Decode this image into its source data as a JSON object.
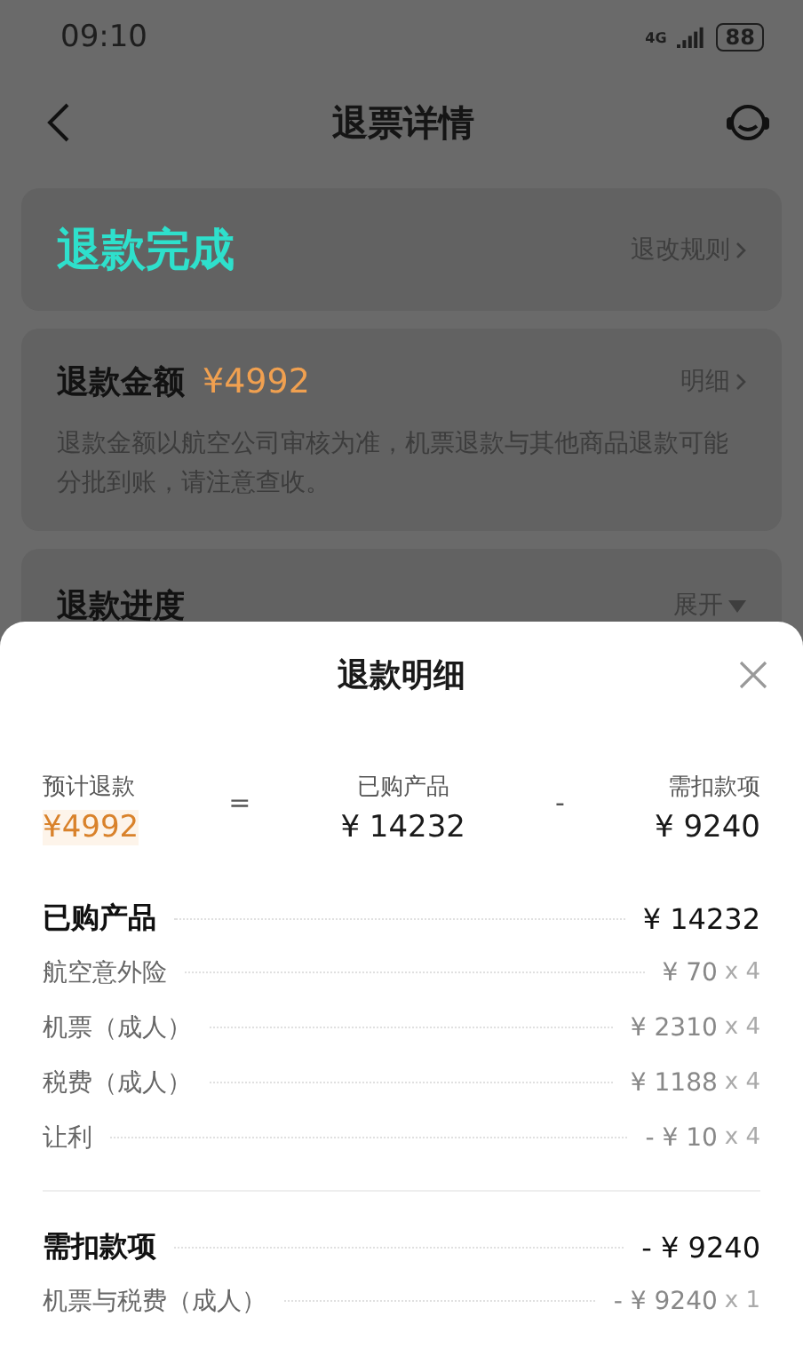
{
  "status_bar": {
    "time": "09:10",
    "network": "4G",
    "battery": "88"
  },
  "header": {
    "title": "退票详情"
  },
  "status_card": {
    "status": "退款完成",
    "link": "退改规则"
  },
  "amount_card": {
    "label": "退款金额",
    "amount": "¥4992",
    "link": "明细",
    "note": "退款金额以航空公司审核为准，机票退款与其他商品退款可能分批到账，请注意查收。"
  },
  "progress_card": {
    "label": "退款进度",
    "toggle": "展开"
  },
  "sheet": {
    "title": "退款明细",
    "formula": [
      {
        "kind": "term",
        "label": "预计退款",
        "value": "¥4992",
        "highlight": true
      },
      {
        "kind": "operator",
        "symbol": "="
      },
      {
        "kind": "term",
        "label": "已购产品",
        "value": "¥ 14232",
        "highlight": false
      },
      {
        "kind": "operator",
        "symbol": "-"
      },
      {
        "kind": "term",
        "label": "需扣款项",
        "value": "¥ 9240",
        "highlight": false
      }
    ],
    "sections": [
      {
        "title": "已购产品",
        "total": "¥ 14232",
        "items": [
          {
            "name": "航空意外险",
            "amount": "¥ 70",
            "qty": "x 4"
          },
          {
            "name": "机票（成人）",
            "amount": "¥ 2310",
            "qty": "x 4"
          },
          {
            "name": "税费（成人）",
            "amount": "¥ 1188",
            "qty": "x 4"
          },
          {
            "name": "让利",
            "amount": "- ¥ 10",
            "qty": "x 4"
          }
        ]
      },
      {
        "title": "需扣款项",
        "total": "- ¥ 9240",
        "items": [
          {
            "name": "机票与税费（成人）",
            "amount": "- ¥ 9240",
            "qty": "x 1"
          }
        ]
      }
    ]
  }
}
